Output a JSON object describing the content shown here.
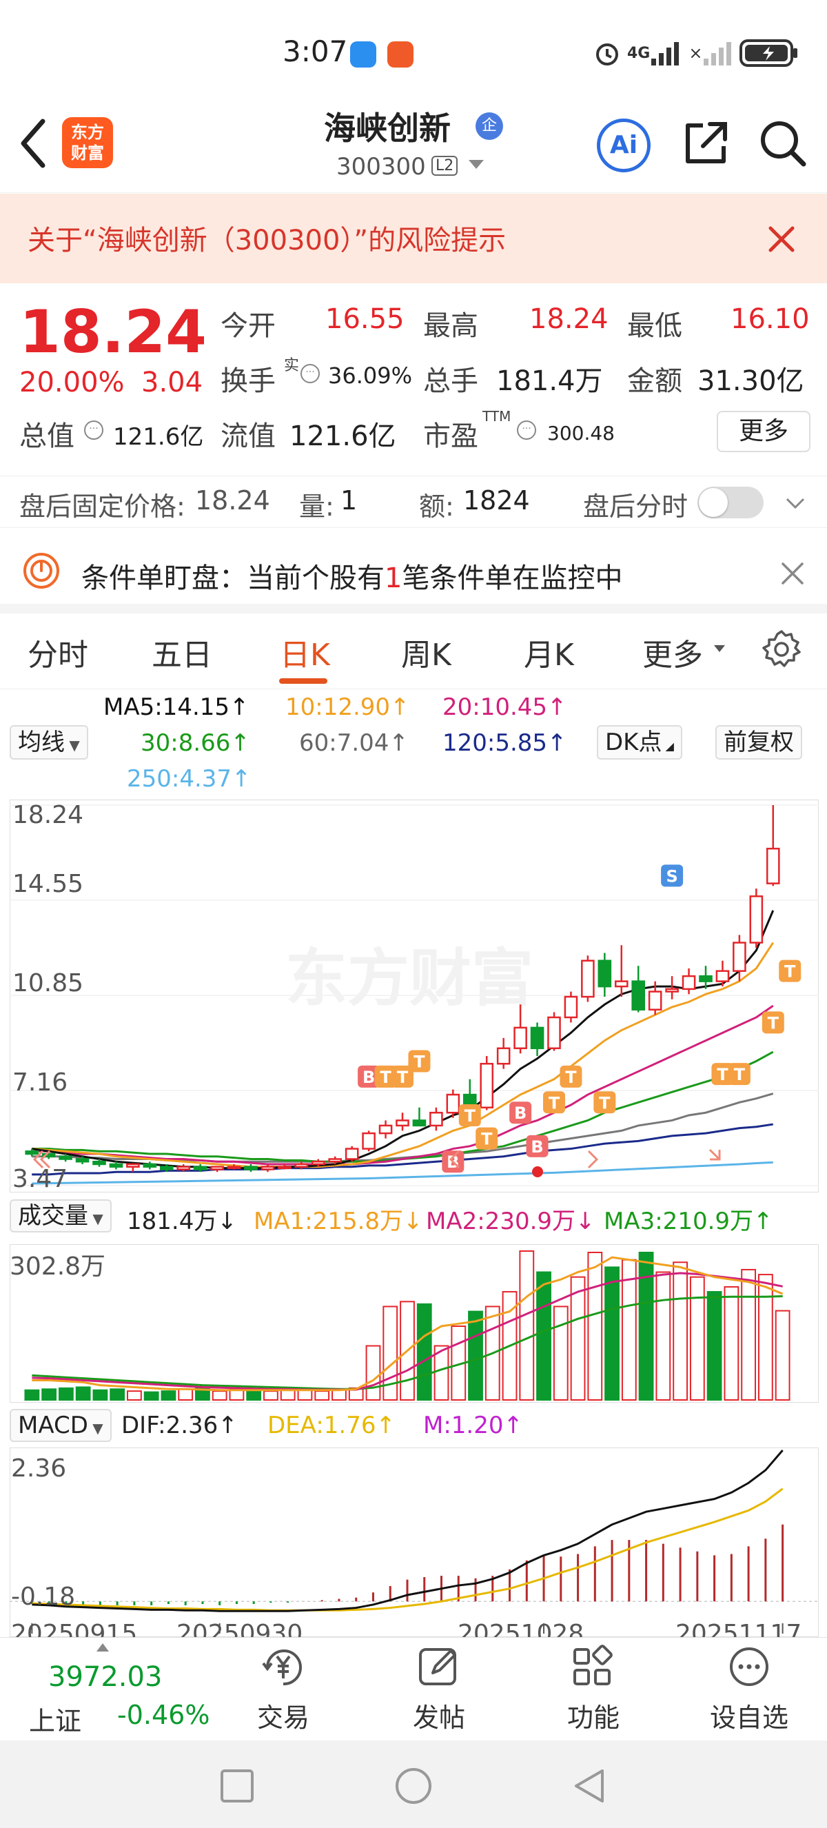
{
  "status_bar": {
    "time": "3:07",
    "network": "4G",
    "signal2": "×"
  },
  "header": {
    "logo_line1": "东方",
    "logo_line2": "财富",
    "stock_name": "海峡创新",
    "badge": "企",
    "stock_code": "300300",
    "level": "L2",
    "ai_label": "Ai"
  },
  "risk_banner": {
    "text": "关于“海峡创新（300300）”的风险提示"
  },
  "quote": {
    "price": "18.24",
    "change_pct": "20.00%",
    "change_amt": "3.04",
    "open_label": "今开",
    "open": "16.55",
    "high_label": "最高",
    "high": "18.24",
    "low_label": "最低",
    "low": "16.10",
    "turnover_label": "换手",
    "turnover_sup": "实",
    "turnover": "36.09%",
    "volume_label": "总手",
    "volume": "181.4万",
    "amount_label": "金额",
    "amount": "31.30亿",
    "mktcap_label": "总值",
    "mktcap": "121.6亿",
    "float_label": "流值",
    "float_cap": "121.6亿",
    "pe_label": "市盈",
    "pe_sup": "TTM",
    "pe": "300.48",
    "more_label": "更多",
    "dots": "···"
  },
  "after_hours": {
    "price_label": "盘后固定价格:",
    "price": "18.24",
    "vol_label": "量:",
    "vol": "1",
    "amt_label": "额:",
    "amt": "1824",
    "timeshare_label": "盘后分时"
  },
  "conditional": {
    "prefix": "条件单盯盘：当前个股有",
    "count": "1",
    "suffix": "笔条件单在监控中"
  },
  "tabs": [
    {
      "label": "分时"
    },
    {
      "label": "五日"
    },
    {
      "label": "日K"
    },
    {
      "label": "周K"
    },
    {
      "label": "月K"
    },
    {
      "label": "更多"
    }
  ],
  "ma_legend": {
    "selector": "均线",
    "ma5": "MA5:14.15↑",
    "ma10": "10:12.90↑",
    "ma20": "20:10.45↑",
    "ma30": "30:8.66↑",
    "ma60": "60:7.04↑",
    "ma120": "120:5.85↑",
    "ma250": "250:4.37↑",
    "dk_label": "DK点",
    "adjust_label": "前复权"
  },
  "colors": {
    "up": "#e4252a",
    "down": "#0a9a2e",
    "ma5": "#111111",
    "ma10": "#f0a020",
    "ma20": "#d0207a",
    "ma30": "#1a9a1a",
    "ma60": "#777777",
    "ma120": "#1a2a8a",
    "ma250": "#5ab4e8"
  },
  "kchart": {
    "y_labels": [
      "18.24",
      "14.55",
      "10.85",
      "7.16",
      "3.47"
    ],
    "watermark": "东方财富",
    "signal_b": "B",
    "signal_t": "T",
    "signal_s": "S"
  },
  "volume": {
    "selector": "成交量",
    "value": "181.4万↓",
    "ma1": "MA1:215.8万↓",
    "ma2": "MA2:230.9万↓",
    "ma3": "MA3:210.9万↑",
    "max_label": "302.8万"
  },
  "macd": {
    "selector": "MACD",
    "dif": "DIF:2.36↑",
    "dea": "DEA:1.76↑",
    "m": "M:1.20↑",
    "max_label": "2.36",
    "min_label": "-0.18",
    "dates": [
      "20250915",
      "20250930",
      "20251028",
      "20251117"
    ]
  },
  "bottom_nav": {
    "index_value": "3972.03",
    "index_name": "上证",
    "index_change": "-0.46%",
    "trade": "交易",
    "post": "发帖",
    "functions": "功能",
    "watchlist": "设自选"
  },
  "chart_data": [
    {
      "type": "candlestick",
      "title": "",
      "ylim": [
        3.47,
        18.24
      ],
      "y_ticks": [
        18.24,
        14.55,
        10.85,
        7.16,
        3.47
      ],
      "candles": [
        [
          4.8,
          4.9,
          4.6,
          4.7
        ],
        [
          4.7,
          4.8,
          4.5,
          4.6
        ],
        [
          4.6,
          4.7,
          4.4,
          4.5
        ],
        [
          4.5,
          4.6,
          4.3,
          4.4
        ],
        [
          4.4,
          4.5,
          4.2,
          4.3
        ],
        [
          4.3,
          4.4,
          4.1,
          4.2
        ],
        [
          4.2,
          4.3,
          4.0,
          4.3
        ],
        [
          4.3,
          4.4,
          4.1,
          4.2
        ],
        [
          4.2,
          4.3,
          4.0,
          4.1
        ],
        [
          4.1,
          4.3,
          4.0,
          4.2
        ],
        [
          4.2,
          4.3,
          4.0,
          4.1
        ],
        [
          4.1,
          4.2,
          4.0,
          4.2
        ],
        [
          4.2,
          4.3,
          4.1,
          4.2
        ],
        [
          4.2,
          4.3,
          4.0,
          4.1
        ],
        [
          4.1,
          4.3,
          4.0,
          4.2
        ],
        [
          4.2,
          4.3,
          4.1,
          4.2
        ],
        [
          4.2,
          4.4,
          4.1,
          4.3
        ],
        [
          4.3,
          4.5,
          4.2,
          4.4
        ],
        [
          4.4,
          4.6,
          4.3,
          4.5
        ],
        [
          4.5,
          5.0,
          4.4,
          4.9
        ],
        [
          4.9,
          5.6,
          4.8,
          5.5
        ],
        [
          5.5,
          6.0,
          5.3,
          5.8
        ],
        [
          5.8,
          6.3,
          5.6,
          6.0
        ],
        [
          6.0,
          6.5,
          5.8,
          5.8
        ],
        [
          5.8,
          6.5,
          5.6,
          6.3
        ],
        [
          6.3,
          7.2,
          6.1,
          7.0
        ],
        [
          7.0,
          7.6,
          6.2,
          6.5
        ],
        [
          6.5,
          8.5,
          6.4,
          8.2
        ],
        [
          8.2,
          9.2,
          8.0,
          8.8
        ],
        [
          8.8,
          10.5,
          8.6,
          9.6
        ],
        [
          9.6,
          9.8,
          8.5,
          8.8
        ],
        [
          8.8,
          10.2,
          8.7,
          10.0
        ],
        [
          10.0,
          11.0,
          9.8,
          10.8
        ],
        [
          10.8,
          12.4,
          10.6,
          12.2
        ],
        [
          12.2,
          12.5,
          10.8,
          11.2
        ],
        [
          11.2,
          12.8,
          10.8,
          11.4
        ],
        [
          11.4,
          12.0,
          10.2,
          10.3
        ],
        [
          10.3,
          11.4,
          10.1,
          11.0
        ],
        [
          11.0,
          11.6,
          10.7,
          11.1
        ],
        [
          11.1,
          11.9,
          10.9,
          11.6
        ],
        [
          11.6,
          12.0,
          11.1,
          11.4
        ],
        [
          11.4,
          12.2,
          11.2,
          11.8
        ],
        [
          11.8,
          13.2,
          11.4,
          12.9
        ],
        [
          12.9,
          15.0,
          12.7,
          14.7
        ],
        [
          15.2,
          18.24,
          15.1,
          16.55
        ]
      ],
      "ma5": [
        4.9,
        4.8,
        4.7,
        4.6,
        4.5,
        4.4,
        4.35,
        4.3,
        4.25,
        4.2,
        4.2,
        4.15,
        4.15,
        4.15,
        4.15,
        4.2,
        4.2,
        4.25,
        4.3,
        4.45,
        4.7,
        5.0,
        5.4,
        5.6,
        5.9,
        6.2,
        6.4,
        6.9,
        7.4,
        8.0,
        8.4,
        8.9,
        9.4,
        10.0,
        10.5,
        10.9,
        11.1,
        11.2,
        11.2,
        11.1,
        11.2,
        11.3,
        11.8,
        12.6,
        14.15
      ],
      "ma10": [
        4.9,
        4.85,
        4.8,
        4.75,
        4.7,
        4.6,
        4.55,
        4.5,
        4.45,
        4.4,
        4.35,
        4.3,
        4.25,
        4.2,
        4.2,
        4.2,
        4.2,
        4.2,
        4.25,
        4.3,
        4.4,
        4.6,
        4.8,
        5.0,
        5.3,
        5.6,
        5.8,
        6.2,
        6.6,
        7.0,
        7.3,
        7.6,
        8.1,
        8.6,
        9.1,
        9.5,
        9.8,
        10.1,
        10.4,
        10.6,
        10.9,
        11.1,
        11.4,
        11.9,
        12.9
      ],
      "ma20": [
        4.8,
        4.8,
        4.75,
        4.7,
        4.7,
        4.65,
        4.6,
        4.55,
        4.5,
        4.5,
        4.45,
        4.4,
        4.4,
        4.35,
        4.3,
        4.3,
        4.3,
        4.3,
        4.3,
        4.3,
        4.35,
        4.4,
        4.5,
        4.6,
        4.7,
        4.9,
        5.0,
        5.2,
        5.5,
        5.8,
        6.0,
        6.3,
        6.6,
        7.0,
        7.3,
        7.6,
        7.9,
        8.2,
        8.5,
        8.8,
        9.1,
        9.4,
        9.7,
        10.0,
        10.45
      ],
      "ma30": [
        4.9,
        4.9,
        4.85,
        4.85,
        4.8,
        4.8,
        4.75,
        4.7,
        4.7,
        4.65,
        4.6,
        4.6,
        4.55,
        4.5,
        4.5,
        4.45,
        4.45,
        4.4,
        4.4,
        4.4,
        4.4,
        4.45,
        4.5,
        4.55,
        4.6,
        4.7,
        4.8,
        4.9,
        5.0,
        5.2,
        5.4,
        5.6,
        5.8,
        6.0,
        6.3,
        6.5,
        6.7,
        6.9,
        7.1,
        7.3,
        7.5,
        7.7,
        8.0,
        8.3,
        8.66
      ],
      "ma60": [
        4.6,
        4.6,
        4.6,
        4.55,
        4.55,
        4.5,
        4.5,
        4.5,
        4.45,
        4.45,
        4.45,
        4.4,
        4.4,
        4.4,
        4.4,
        4.4,
        4.4,
        4.4,
        4.4,
        4.45,
        4.45,
        4.5,
        4.55,
        4.6,
        4.65,
        4.7,
        4.75,
        4.8,
        4.9,
        5.0,
        5.1,
        5.2,
        5.3,
        5.4,
        5.5,
        5.6,
        5.8,
        5.9,
        6.0,
        6.2,
        6.3,
        6.5,
        6.7,
        6.85,
        7.04
      ],
      "ma120": [
        3.9,
        3.9,
        3.95,
        3.95,
        3.95,
        4.0,
        4.0,
        4.0,
        4.05,
        4.05,
        4.05,
        4.1,
        4.1,
        4.1,
        4.1,
        4.15,
        4.15,
        4.15,
        4.2,
        4.2,
        4.25,
        4.25,
        4.3,
        4.35,
        4.4,
        4.45,
        4.5,
        4.55,
        4.6,
        4.7,
        4.8,
        4.85,
        4.9,
        5.0,
        5.1,
        5.15,
        5.2,
        5.3,
        5.4,
        5.45,
        5.5,
        5.6,
        5.7,
        5.75,
        5.85
      ],
      "ma250": [
        3.55,
        3.56,
        3.57,
        3.58,
        3.59,
        3.6,
        3.61,
        3.62,
        3.63,
        3.64,
        3.65,
        3.66,
        3.67,
        3.68,
        3.69,
        3.7,
        3.71,
        3.72,
        3.73,
        3.74,
        3.75,
        3.77,
        3.79,
        3.81,
        3.83,
        3.85,
        3.87,
        3.89,
        3.91,
        3.93,
        3.95,
        3.97,
        4.0,
        4.03,
        4.06,
        4.09,
        4.12,
        4.15,
        4.18,
        4.21,
        4.24,
        4.27,
        4.3,
        4.34,
        4.37
      ]
    },
    {
      "type": "bar",
      "title": "成交量",
      "ylim": [
        0,
        302.8
      ],
      "unit": "万",
      "values": [
        20,
        22,
        24,
        26,
        20,
        22,
        18,
        16,
        18,
        22,
        24,
        18,
        22,
        20,
        18,
        22,
        20,
        18,
        22,
        24,
        110,
        190,
        200,
        195,
        110,
        150,
        180,
        190,
        220,
        302.8,
        260,
        190,
        250,
        300,
        270,
        285,
        300,
        260,
        280,
        250,
        220,
        230,
        265,
        255,
        181.4
      ],
      "ma1": [
        40,
        40,
        38,
        36,
        30,
        28,
        26,
        24,
        22,
        22,
        21,
        20,
        20,
        20,
        20,
        20,
        20,
        20,
        20,
        22,
        40,
        70,
        100,
        130,
        150,
        155,
        160,
        170,
        180,
        210,
        235,
        245,
        260,
        270,
        290,
        285,
        280,
        275,
        270,
        260,
        250,
        245,
        240,
        230,
        215.8
      ],
      "ma2": [
        45,
        44,
        42,
        40,
        38,
        36,
        34,
        32,
        30,
        28,
        26,
        25,
        24,
        23,
        22,
        22,
        21,
        21,
        21,
        21,
        30,
        45,
        60,
        80,
        100,
        115,
        130,
        145,
        160,
        175,
        190,
        205,
        220,
        230,
        240,
        245,
        250,
        255,
        258,
        256,
        252,
        248,
        244,
        238,
        230.9
      ],
      "ma3": [
        50,
        48,
        46,
        44,
        42,
        40,
        38,
        36,
        34,
        32,
        30,
        29,
        28,
        27,
        26,
        25,
        24,
        23,
        22,
        22,
        25,
        32,
        40,
        50,
        62,
        72,
        82,
        95,
        110,
        125,
        140,
        152,
        165,
        175,
        185,
        192,
        198,
        203,
        206,
        208,
        209,
        210,
        210,
        210,
        210.9
      ]
    },
    {
      "type": "line",
      "title": "MACD",
      "ylim": [
        -0.18,
        2.36
      ],
      "dif": [
        -0.05,
        -0.06,
        -0.08,
        -0.09,
        -0.1,
        -0.11,
        -0.12,
        -0.13,
        -0.13,
        -0.14,
        -0.14,
        -0.15,
        -0.15,
        -0.15,
        -0.15,
        -0.15,
        -0.14,
        -0.13,
        -0.12,
        -0.1,
        -0.05,
        0.02,
        0.1,
        0.15,
        0.2,
        0.25,
        0.28,
        0.35,
        0.45,
        0.6,
        0.72,
        0.8,
        0.9,
        1.05,
        1.2,
        1.3,
        1.4,
        1.45,
        1.5,
        1.55,
        1.6,
        1.7,
        1.85,
        2.05,
        2.36
      ],
      "dea": [
        -0.03,
        -0.04,
        -0.05,
        -0.06,
        -0.07,
        -0.08,
        -0.09,
        -0.1,
        -0.11,
        -0.11,
        -0.12,
        -0.12,
        -0.13,
        -0.13,
        -0.14,
        -0.14,
        -0.14,
        -0.14,
        -0.14,
        -0.13,
        -0.12,
        -0.1,
        -0.07,
        -0.04,
        0,
        0.05,
        0.1,
        0.15,
        0.2,
        0.28,
        0.36,
        0.45,
        0.53,
        0.62,
        0.72,
        0.82,
        0.92,
        1.0,
        1.08,
        1.16,
        1.24,
        1.33,
        1.42,
        1.56,
        1.76
      ],
      "m": [
        -0.04,
        -0.04,
        -0.05,
        -0.06,
        -0.06,
        -0.06,
        -0.06,
        -0.06,
        -0.04,
        -0.06,
        -0.04,
        -0.06,
        -0.04,
        -0.04,
        -0.02,
        -0.02,
        0,
        0.02,
        0.04,
        0.06,
        0.14,
        0.24,
        0.34,
        0.38,
        0.4,
        0.4,
        0.36,
        0.4,
        0.5,
        0.64,
        0.72,
        0.7,
        0.74,
        0.86,
        0.96,
        0.96,
        0.96,
        0.9,
        0.84,
        0.78,
        0.72,
        0.74,
        0.86,
        0.98,
        1.2
      ],
      "x_ticks": [
        "20250915",
        "20250930",
        "20251028",
        "20251117"
      ]
    }
  ]
}
